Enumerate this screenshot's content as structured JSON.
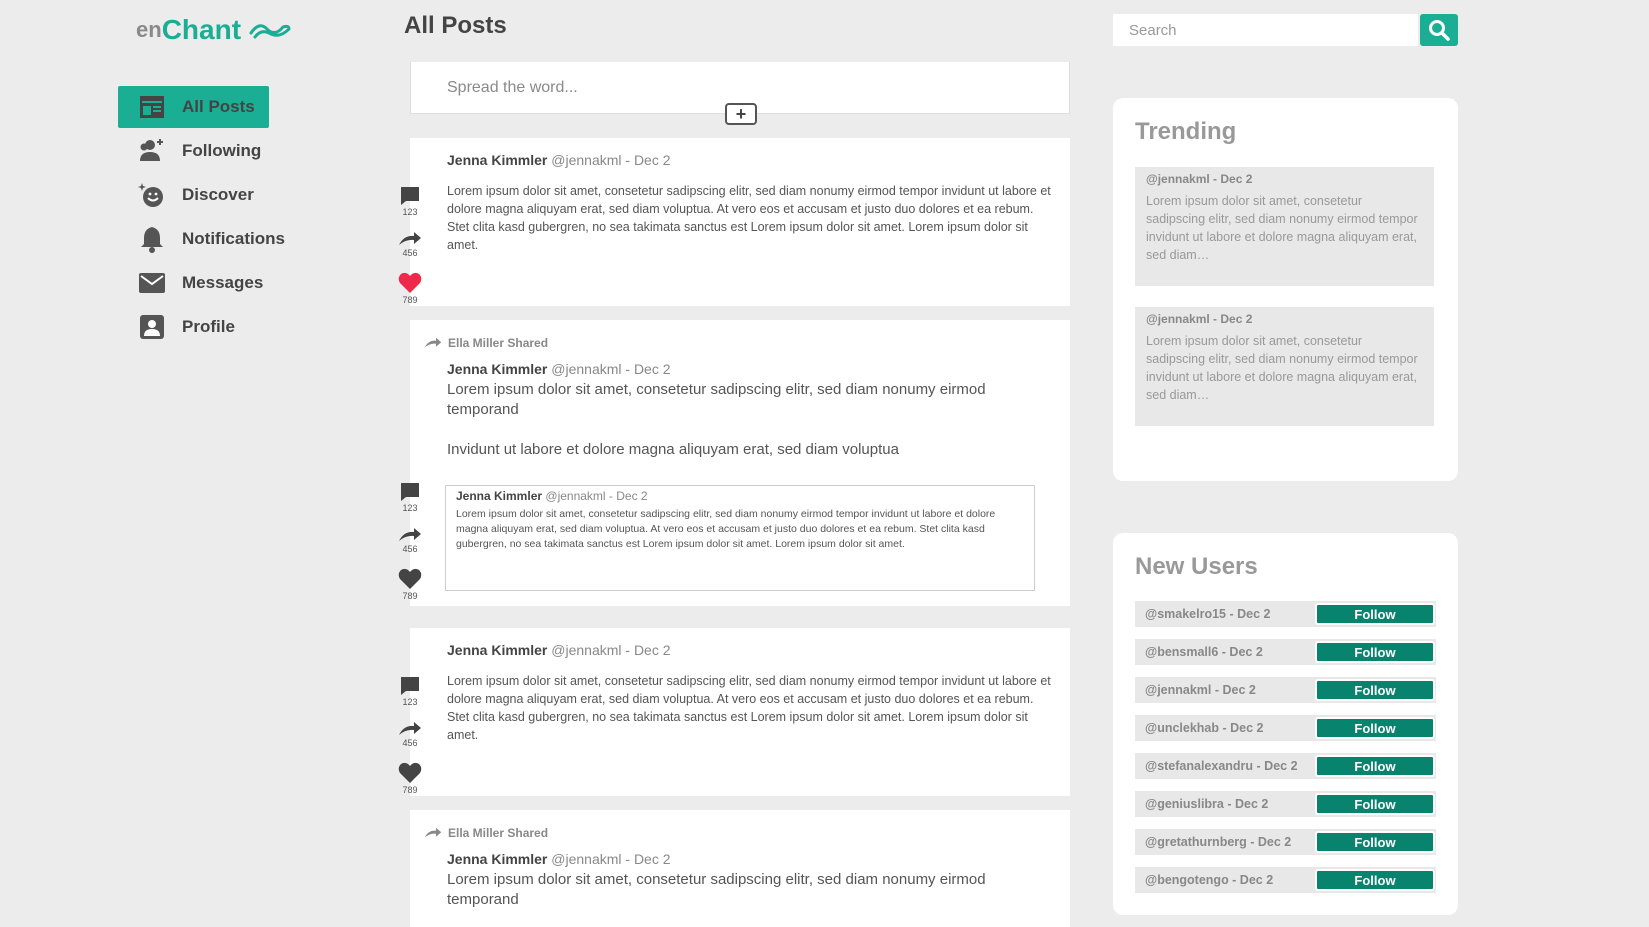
{
  "brand": {
    "prefix": "en",
    "name": "Chant",
    "accent": "#1aae95"
  },
  "nav": {
    "items": [
      {
        "label": "All Posts",
        "icon": "feed-icon",
        "active": true
      },
      {
        "label": "Following",
        "icon": "user-plus-icon"
      },
      {
        "label": "Discover",
        "icon": "discover-icon"
      },
      {
        "label": "Notifications",
        "icon": "bell-icon"
      },
      {
        "label": "Messages",
        "icon": "mail-icon"
      },
      {
        "label": "Profile",
        "icon": "profile-icon"
      }
    ]
  },
  "main": {
    "title": "All Posts",
    "composer_placeholder": "Spread the word...",
    "posts": [
      {
        "author": "Jenna Kimmler",
        "meta": "@jennakml - Dec 2",
        "body": "Lorem ipsum dolor sit amet, consetetur sadipscing elitr, sed diam nonumy eirmod tempor invidunt ut labore et dolore magna aliquyam erat, sed diam voluptua. At vero eos et accusam et justo duo dolores et ea rebum. Stet clita kasd gubergren, no sea takimata sanctus est Lorem ipsum dolor sit amet. Lorem ipsum dolor sit amet.",
        "comments": "123",
        "shares": "456",
        "likes": "789"
      },
      {
        "shared_by": "Ella Miller Shared",
        "author": "Jenna Kimmler",
        "meta": "@jennakml - Dec 2",
        "line1": "Lorem ipsum dolor sit amet, consetetur sadipscing elitr, sed diam nonumy eirmod temporand",
        "line2": "Invidunt ut labore et dolore magna aliquyam erat, sed diam voluptua",
        "quote": {
          "author": "Jenna Kimmler",
          "meta": "@jennakml - Dec 2",
          "body": "Lorem ipsum dolor sit amet, consetetur sadipscing elitr, sed diam nonumy eirmod tempor invidunt ut labore et dolore magna aliquyam erat, sed diam voluptua. At vero eos et accusam et justo duo dolores et ea rebum. Stet clita kasd gubergren, no sea takimata sanctus est Lorem ipsum dolor sit amet. Lorem ipsum dolor sit amet."
        },
        "comments": "123",
        "shares": "456",
        "likes": "789"
      },
      {
        "author": "Jenna Kimmler",
        "meta": "@jennakml - Dec 2",
        "body": "Lorem ipsum dolor sit amet, consetetur sadipscing elitr, sed diam nonumy eirmod tempor invidunt ut labore et dolore magna aliquyam erat, sed diam voluptua. At vero eos et accusam et justo duo dolores et ea rebum. Stet clita kasd gubergren, no sea takimata sanctus est Lorem ipsum dolor sit amet. Lorem ipsum dolor sit amet.",
        "comments": "123",
        "shares": "456",
        "likes": "789"
      },
      {
        "shared_by": "Ella Miller Shared",
        "author": "Jenna Kimmler",
        "meta": "@jennakml - Dec 2",
        "line1": "Lorem ipsum dolor sit amet, consetetur sadipscing elitr, sed diam nonumy eirmod temporand"
      }
    ]
  },
  "search": {
    "placeholder": "Search"
  },
  "trending": {
    "title": "Trending",
    "items": [
      {
        "meta": "@jennakml - Dec 2",
        "body": "Lorem ipsum dolor sit amet, consetetur sadipscing elitr, sed diam nonumy eirmod tempor invidunt ut labore et dolore magna aliquyam erat, sed diam…"
      },
      {
        "meta": "@jennakml - Dec 2",
        "body": "Lorem ipsum dolor sit amet, consetetur sadipscing elitr, sed diam nonumy eirmod tempor invidunt ut labore et dolore magna aliquyam erat, sed diam…"
      }
    ]
  },
  "new_users": {
    "title": "New Users",
    "follow_label": "Follow",
    "items": [
      "@smakelro15 - Dec 2",
      "@bensmall6 - Dec 2",
      "@jennakml - Dec 2",
      "@unclekhab - Dec 2",
      "@stefanalexandru - Dec 2",
      "@geniuslibra - Dec 2",
      "@gretathurnberg - Dec 2",
      "@bengotengo - Dec 2"
    ]
  },
  "colors": {
    "accent": "#1aae95",
    "follow": "#08836d",
    "like": "#f0284a"
  }
}
